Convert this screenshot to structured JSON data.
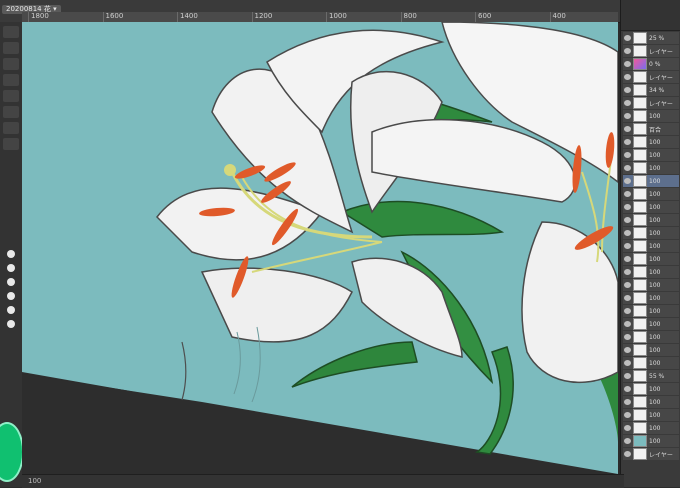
{
  "document": {
    "tab_label": "20200814 花 ▾"
  },
  "ruler": {
    "labels": [
      "1800",
      "1600",
      "1400",
      "1200",
      "1000",
      "800",
      "600",
      "400"
    ]
  },
  "layers": [
    {
      "label": "25 %",
      "thumb": "white"
    },
    {
      "label": "レイヤー",
      "thumb": "white"
    },
    {
      "label": "0 %",
      "thumb": "pink"
    },
    {
      "label": "レイヤー",
      "thumb": "white"
    },
    {
      "label": "34 %",
      "thumb": "white"
    },
    {
      "label": "レイヤー",
      "thumb": "white"
    },
    {
      "label": "100",
      "thumb": "white"
    },
    {
      "label": "百合",
      "thumb": "white"
    },
    {
      "label": "100",
      "thumb": "white"
    },
    {
      "label": "100",
      "thumb": "white"
    },
    {
      "label": "100",
      "thumb": "white"
    },
    {
      "label": "100",
      "thumb": "white",
      "selected": true
    },
    {
      "label": "100",
      "thumb": "white"
    },
    {
      "label": "100",
      "thumb": "white"
    },
    {
      "label": "100",
      "thumb": "white"
    },
    {
      "label": "100",
      "thumb": "white"
    },
    {
      "label": "100",
      "thumb": "white"
    },
    {
      "label": "100",
      "thumb": "white"
    },
    {
      "label": "100",
      "thumb": "white"
    },
    {
      "label": "100",
      "thumb": "white"
    },
    {
      "label": "100",
      "thumb": "white"
    },
    {
      "label": "100",
      "thumb": "white"
    },
    {
      "label": "100",
      "thumb": "white"
    },
    {
      "label": "100",
      "thumb": "white"
    },
    {
      "label": "100",
      "thumb": "white"
    },
    {
      "label": "100",
      "thumb": "white"
    },
    {
      "label": "55 %",
      "thumb": "white"
    },
    {
      "label": "100",
      "thumb": "white"
    },
    {
      "label": "100",
      "thumb": "white"
    },
    {
      "label": "100",
      "thumb": "white"
    },
    {
      "label": "100",
      "thumb": "white"
    },
    {
      "label": "100",
      "thumb": "teal"
    },
    {
      "label": "レイヤー",
      "thumb": "white"
    }
  ],
  "status": {
    "zoom_text": "100"
  },
  "colors": {
    "canvas_bg": "#7cbbbe",
    "petal": "#f2f2f2",
    "leaf": "#2f8a3e",
    "anther": "#e05a2a",
    "stamen": "#d6d87a"
  }
}
